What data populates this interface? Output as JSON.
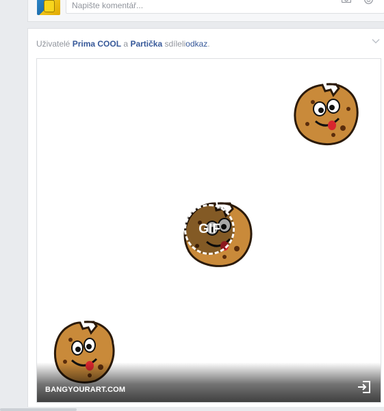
{
  "comment_box": {
    "placeholder": "Napište komentář...",
    "camera_icon": "camera-icon",
    "emoji_icon": "smile-icon"
  },
  "post": {
    "share_prefix": "Uživatelé",
    "user_1": "Prima COOL",
    "conjunction": "a",
    "user_2": "Partička",
    "share_verb": "sdíleli",
    "share_object": "odkaz",
    "share_period": ".",
    "menu_icon": "chevron-down-icon"
  },
  "media": {
    "badge_label": "GIF",
    "source": "BANGYOURART.COM",
    "open_icon": "open-link-icon"
  },
  "colors": {
    "link": "#365899",
    "muted": "#90949c",
    "background": "#e9ebee"
  }
}
